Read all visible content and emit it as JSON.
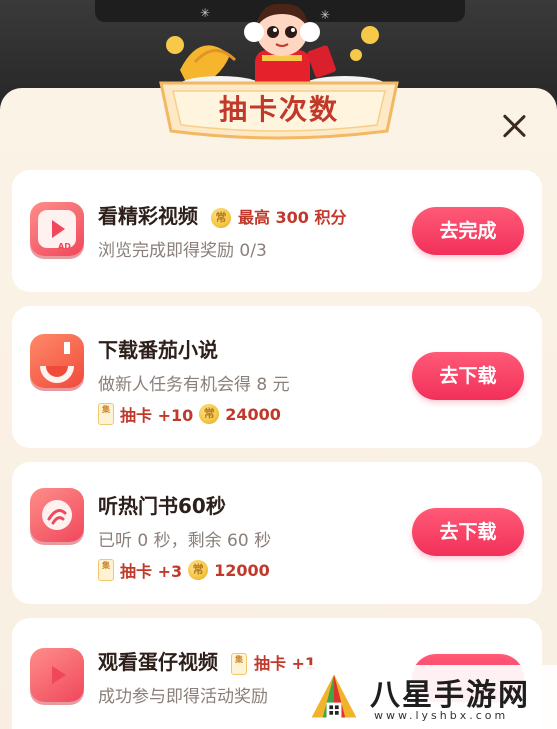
{
  "dialog": {
    "title": "抽卡次数"
  },
  "tasks": [
    {
      "title": "看精彩视频",
      "highlight": "最高 300 积分",
      "subtitle": "浏览完成即得奖励 0/3",
      "button": "去完成",
      "icon": "ad-video-icon"
    },
    {
      "title": "下载番茄小说",
      "subtitle": "做新人任务有机会得 8 元",
      "reward_cards": "抽卡 +10",
      "reward_points": "24000",
      "button": "去下载",
      "icon": "tomato-novel-icon"
    },
    {
      "title": "听热门书60秒",
      "subtitle": "已听 0 秒，剩余 60 秒",
      "reward_cards": "抽卡 +3",
      "reward_points": "12000",
      "button": "去下载",
      "icon": "audio-book-icon"
    },
    {
      "title": "观看蛋仔视频",
      "highlight": "抽卡 +1",
      "subtitle": "成功参与即得活动奖励",
      "button": "",
      "icon": "play-video-icon"
    }
  ],
  "coin_glyph": "常",
  "card_glyph": "集",
  "watermark": {
    "text": "八星手游网",
    "url": "www.lyshbx.com"
  },
  "colors": {
    "accent": "#f2305a",
    "title_red": "#c0392b",
    "sheet_bg": "#fbf3e6"
  }
}
